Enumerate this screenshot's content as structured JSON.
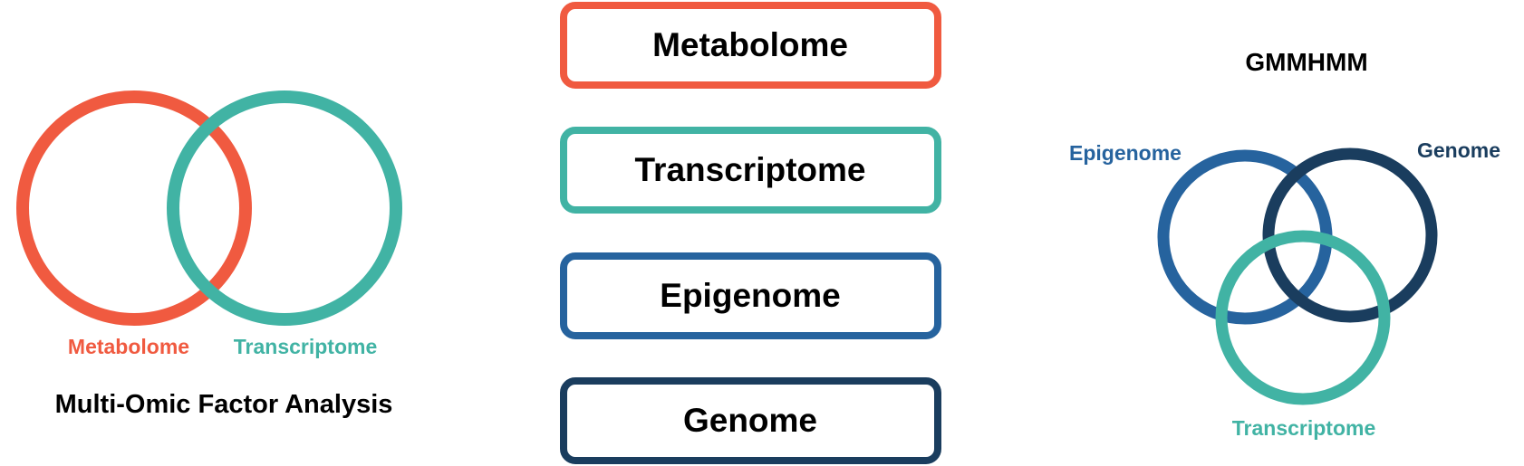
{
  "colors": {
    "metabolome": "#f05a40",
    "transcriptome": "#41b3a4",
    "epigenome": "#26639e",
    "genome": "#1a3d5e",
    "text": "#000000"
  },
  "mofa": {
    "title": "Multi-Omic Factor Analysis",
    "circles": [
      {
        "label": "Metabolome",
        "color_key": "metabolome"
      },
      {
        "label": "Transcriptome",
        "color_key": "transcriptome"
      }
    ]
  },
  "omics": {
    "boxes": [
      {
        "label": "Metabolome",
        "color_key": "metabolome"
      },
      {
        "label": "Transcriptome",
        "color_key": "transcriptome"
      },
      {
        "label": "Epigenome",
        "color_key": "epigenome"
      },
      {
        "label": "Genome",
        "color_key": "genome"
      }
    ]
  },
  "gmmhmm": {
    "title": "GMMHMM",
    "circles": [
      {
        "label": "Epigenome",
        "color_key": "epigenome"
      },
      {
        "label": "Genome",
        "color_key": "genome"
      },
      {
        "label": "Transcriptome",
        "color_key": "transcriptome"
      }
    ]
  }
}
